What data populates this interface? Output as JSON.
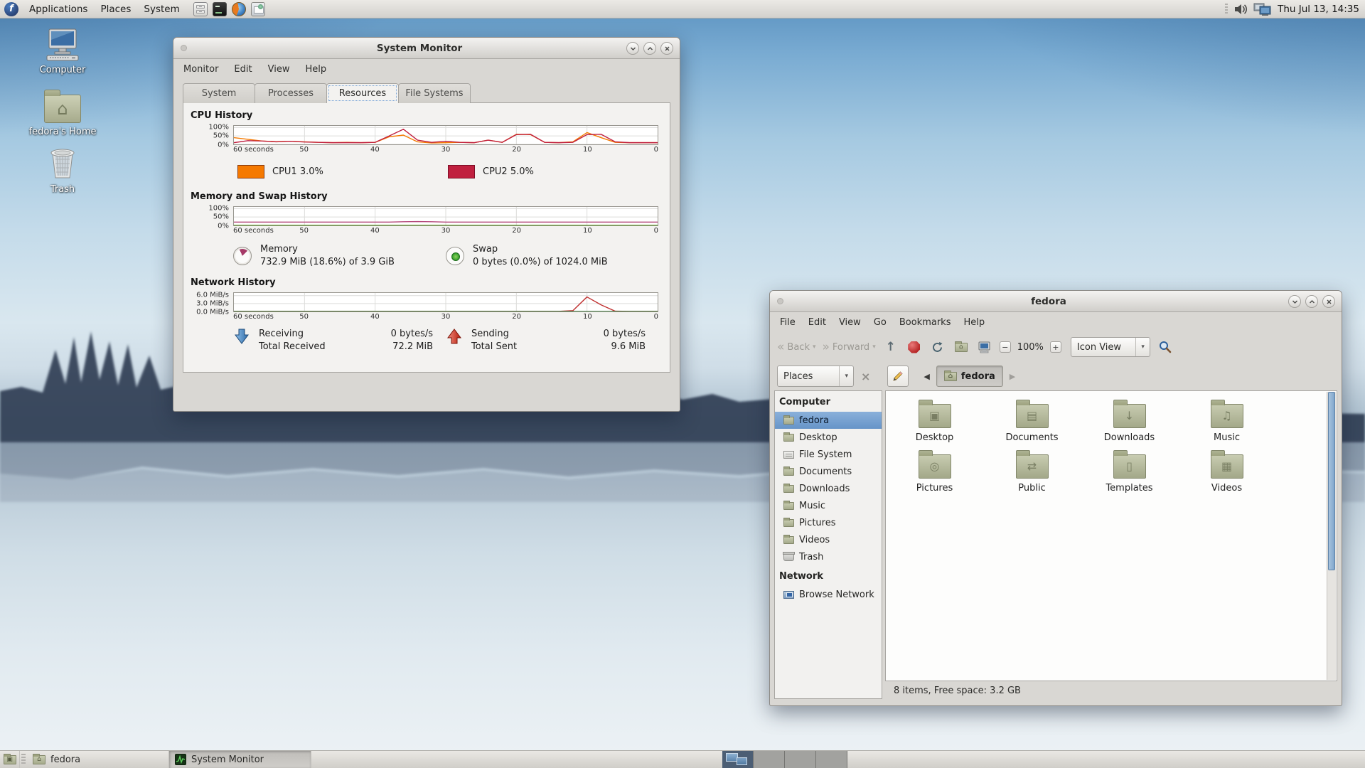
{
  "top_panel": {
    "menus": [
      "Applications",
      "Places",
      "System"
    ],
    "launcher_icons": [
      "file-manager",
      "terminal",
      "firefox",
      "mail"
    ],
    "clock": "Thu Jul 13, 14:35"
  },
  "desktop_icons": [
    {
      "label": "Computer"
    },
    {
      "label": "fedora's Home"
    },
    {
      "label": "Trash"
    }
  ],
  "system_monitor": {
    "title": "System Monitor",
    "menu": [
      "Monitor",
      "Edit",
      "View",
      "Help"
    ],
    "tabs": [
      "System",
      "Processes",
      "Resources",
      "File Systems"
    ],
    "active_tab": "Resources",
    "cpu": {
      "heading": "CPU History",
      "legend": [
        {
          "label": "CPU1  3.0%",
          "color": "#f57900"
        },
        {
          "label": "CPU2  5.0%",
          "color": "#c0203f"
        }
      ]
    },
    "memory": {
      "heading": "Memory and Swap History",
      "memory_label": "Memory",
      "memory_value": "732.9 MiB (18.6%) of 3.9 GiB",
      "swap_label": "Swap",
      "swap_value": "0 bytes (0.0%) of 1024.0 MiB"
    },
    "network": {
      "heading": "Network History",
      "receiving_label": "Receiving",
      "receiving_value": "0 bytes/s",
      "total_received_label": "Total Received",
      "total_received_value": "72.2 MiB",
      "sending_label": "Sending",
      "sending_value": "0 bytes/s",
      "total_sent_label": "Total Sent",
      "total_sent_value": "9.6 MiB"
    }
  },
  "chart_data": [
    {
      "type": "line",
      "id": "cpu",
      "title": "CPU History",
      "x_ticks": [
        "60 seconds",
        "50",
        "40",
        "30",
        "20",
        "10",
        "0"
      ],
      "y_ticks": [
        "100%",
        "50%",
        "0%"
      ],
      "grid_values": [
        100,
        50,
        0
      ],
      "ymax": 110,
      "series": [
        {
          "name": "CPU1",
          "color": "#f57900",
          "values": [
            40,
            30,
            20,
            16,
            18,
            15,
            12,
            10,
            12,
            10,
            12,
            45,
            55,
            15,
            8,
            10,
            12,
            10,
            25,
            12,
            60,
            58,
            12,
            10,
            15,
            70,
            40,
            12,
            10,
            10,
            10
          ]
        },
        {
          "name": "CPU2",
          "color": "#c0203f",
          "values": [
            10,
            22,
            20,
            15,
            18,
            14,
            12,
            10,
            10,
            10,
            12,
            50,
            90,
            25,
            12,
            18,
            12,
            10,
            25,
            12,
            58,
            60,
            12,
            10,
            12,
            58,
            60,
            15,
            10,
            10,
            10
          ]
        }
      ]
    },
    {
      "type": "line",
      "id": "memory",
      "title": "Memory and Swap History",
      "x_ticks": [
        "60 seconds",
        "50",
        "40",
        "30",
        "20",
        "10",
        "0"
      ],
      "y_ticks": [
        "100%",
        "50%",
        "0%"
      ],
      "grid_values": [
        100,
        50,
        0
      ],
      "ymax": 110,
      "series": [
        {
          "name": "Memory",
          "color": "#b4487a",
          "values": [
            20,
            20,
            20,
            20,
            20,
            20,
            20,
            20,
            20,
            20,
            20,
            20,
            22,
            23,
            22,
            20,
            20,
            20,
            20,
            20,
            20,
            20,
            20,
            20,
            20,
            20,
            20,
            20,
            20,
            20,
            20
          ]
        },
        {
          "name": "Swap",
          "color": "#4e9a06",
          "values": [
            1,
            1,
            1,
            1,
            1,
            1,
            1,
            1,
            1,
            1,
            1,
            1,
            1,
            1,
            1,
            1,
            1,
            1,
            1,
            1,
            1,
            1,
            1,
            1,
            1,
            1,
            1,
            1,
            1,
            1,
            1
          ]
        }
      ]
    },
    {
      "type": "line",
      "id": "network",
      "title": "Network History",
      "x_ticks": [
        "60 seconds",
        "50",
        "40",
        "30",
        "20",
        "10",
        "0"
      ],
      "y_ticks": [
        "6.0 MiB/s",
        "3.0 MiB/s",
        "0.0 MiB/s"
      ],
      "grid_values": [
        6,
        3,
        0
      ],
      "ymax": 7,
      "series": [
        {
          "name": "Receiving",
          "color": "#c03030",
          "values": [
            0.05,
            0.05,
            0.05,
            0.05,
            0.05,
            0.05,
            0.05,
            0.05,
            0.05,
            0.05,
            0.05,
            0.05,
            0.05,
            0.05,
            0.05,
            0.05,
            0.05,
            0.05,
            0.05,
            0.05,
            0.05,
            0.05,
            0.05,
            0.05,
            0.3,
            5.5,
            2.5,
            0.1,
            0.05,
            0.05,
            0.05
          ]
        },
        {
          "name": "Sending",
          "color": "#2e7d2e",
          "values": [
            0.02,
            0.02,
            0.02,
            0.02,
            0.02,
            0.02,
            0.02,
            0.02,
            0.02,
            0.02,
            0.02,
            0.02,
            0.02,
            0.02,
            0.02,
            0.02,
            0.02,
            0.02,
            0.02,
            0.02,
            0.02,
            0.02,
            0.02,
            0.02,
            0.02,
            0.02,
            0.02,
            0.02,
            0.02,
            0.02,
            0.02
          ]
        }
      ]
    }
  ],
  "file_manager": {
    "title": "fedora",
    "menu": [
      "File",
      "Edit",
      "View",
      "Go",
      "Bookmarks",
      "Help"
    ],
    "toolbar": {
      "back": "Back",
      "forward": "Forward",
      "zoom_level": "100%",
      "view_mode": "Icon View"
    },
    "location": {
      "places": "Places",
      "breadcrumb": "fedora"
    },
    "sidebar": {
      "computer_header": "Computer",
      "items": [
        {
          "label": "fedora",
          "icon": "home-folder",
          "selected": true
        },
        {
          "label": "Desktop",
          "icon": "folder"
        },
        {
          "label": "File System",
          "icon": "drive"
        },
        {
          "label": "Documents",
          "icon": "folder"
        },
        {
          "label": "Downloads",
          "icon": "folder"
        },
        {
          "label": "Music",
          "icon": "folder"
        },
        {
          "label": "Pictures",
          "icon": "folder"
        },
        {
          "label": "Videos",
          "icon": "folder"
        },
        {
          "label": "Trash",
          "icon": "trash"
        }
      ],
      "network_header": "Network",
      "network_items": [
        {
          "label": "Browse Network",
          "icon": "network"
        }
      ]
    },
    "folders": [
      {
        "label": "Desktop",
        "emblem": "desktop"
      },
      {
        "label": "Documents",
        "emblem": "documents"
      },
      {
        "label": "Downloads",
        "emblem": "downloads"
      },
      {
        "label": "Music",
        "emblem": "music"
      },
      {
        "label": "Pictures",
        "emblem": "pictures"
      },
      {
        "label": "Public",
        "emblem": "public"
      },
      {
        "label": "Templates",
        "emblem": "templates"
      },
      {
        "label": "Videos",
        "emblem": "videos"
      }
    ],
    "statusbar": "8 items, Free space: 3.2 GB"
  },
  "taskbar": {
    "items": [
      {
        "label": "fedora",
        "active": false
      },
      {
        "label": "System Monitor",
        "active": true
      }
    ],
    "workspaces": {
      "count": 4,
      "active": 0
    }
  }
}
